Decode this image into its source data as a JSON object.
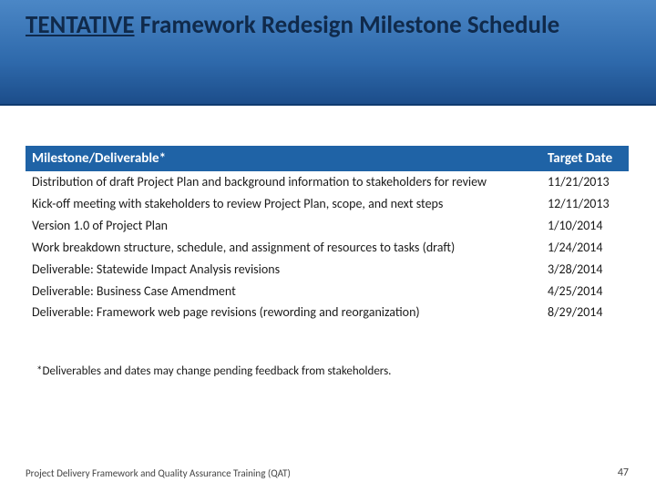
{
  "title": {
    "prefix": "TENTATIVE",
    "rest": " Framework Redesign Milestone Schedule"
  },
  "table": {
    "headers": {
      "milestone": "Milestone/Deliverable*",
      "date": "Target Date"
    },
    "rows": [
      {
        "milestone": "Distribution of draft Project Plan and background information to stakeholders for review",
        "date": "11/21/2013"
      },
      {
        "milestone": "Kick-off meeting with stakeholders to review Project Plan, scope, and next steps",
        "date": "12/11/2013"
      },
      {
        "milestone": "Version 1.0 of Project Plan",
        "date": "1/10/2014"
      },
      {
        "milestone": "Work breakdown structure, schedule, and assignment of resources to tasks (draft)",
        "date": "1/24/2014"
      },
      {
        "milestone": "Deliverable: Statewide Impact Analysis revisions",
        "date": "3/28/2014"
      },
      {
        "milestone": "Deliverable: Business Case Amendment",
        "date": "4/25/2014"
      },
      {
        "milestone": "Deliverable: Framework web page revisions (rewording and reorganization)",
        "date": "8/29/2014"
      }
    ]
  },
  "footnote": "*Deliverables and dates may change pending feedback from stakeholders.",
  "footer": "Project Delivery Framework and Quality Assurance Training (QAT)",
  "page_number": "47"
}
